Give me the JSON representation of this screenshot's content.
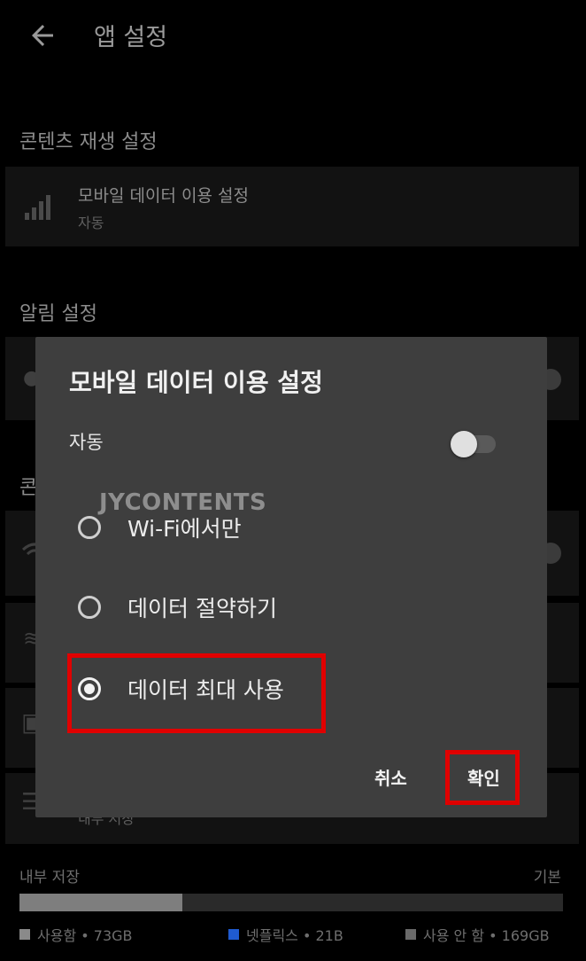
{
  "header": {
    "title": "앱 설정",
    "back_icon": "arrow-left-icon"
  },
  "playback": {
    "section_title": "콘텐츠 재생 설정",
    "mobile_data": {
      "title": "모바일 데이터 이용 설정",
      "value": "자동",
      "icon": "signal-bars-icon"
    }
  },
  "notifications": {
    "section_title": "알림 설정"
  },
  "obscured": {
    "section_fragment": "콘",
    "row_fragment": "내부 저장"
  },
  "storage": {
    "label": "내부 저장",
    "default_label": "기본",
    "used_fraction": 0.3,
    "legend": [
      {
        "label": "사용함 • 73GB",
        "color": "#8a8a8a"
      },
      {
        "label": "넷플릭스 • 21B",
        "color": "#1f5bd0"
      },
      {
        "label": "사용 안 함 • 169GB",
        "color": "#6a6a6a"
      }
    ]
  },
  "dialog": {
    "title": "모바일 데이터 이용 설정",
    "auto_label": "자동",
    "auto_enabled": false,
    "watermark": "JYCONTENTS",
    "options": [
      {
        "label": "Wi-Fi에서만",
        "selected": false
      },
      {
        "label": "데이터 절약하기",
        "selected": false
      },
      {
        "label": "데이터 최대 사용",
        "selected": true
      }
    ],
    "cancel_label": "취소",
    "confirm_label": "확인"
  },
  "colors": {
    "highlight": "#e00000",
    "dialog_bg": "#3e3e3e"
  }
}
